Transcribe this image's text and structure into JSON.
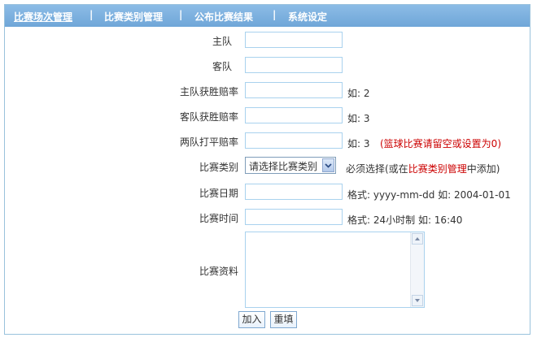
{
  "nav": {
    "items": [
      "比赛场次管理",
      "比赛类别管理",
      "公布比赛结果",
      "系统设定"
    ],
    "separator": "|"
  },
  "form": {
    "home_team": {
      "label": "主队",
      "value": ""
    },
    "away_team": {
      "label": "客队",
      "value": ""
    },
    "home_win_odds": {
      "label": "主队获胜赔率",
      "value": "",
      "hint": "如: 2"
    },
    "away_win_odds": {
      "label": "客队获胜赔率",
      "value": "",
      "hint": "如: 3"
    },
    "draw_odds": {
      "label": "两队打平赔率",
      "value": "",
      "hint": "如: 3",
      "note": "(篮球比赛请留空或设置为0)"
    },
    "category": {
      "label": "比赛类别",
      "selected": "请选择比赛类别",
      "hint_prefix": "必须选择(或在",
      "hint_link": "比赛类别管理",
      "hint_suffix": "中添加)"
    },
    "date": {
      "label": "比赛日期",
      "value": "",
      "hint": "格式: yyyy-mm-dd  如: 2004-01-01"
    },
    "time": {
      "label": "比赛时间",
      "value": "",
      "hint": "格式: 24小时制  如: 16:40"
    },
    "info": {
      "label": "比赛资料",
      "value": ""
    }
  },
  "buttons": {
    "submit": "加入",
    "reset": "重填"
  },
  "colors": {
    "nav_bg": "#7ab0df",
    "border": "#9ac2dc",
    "accent_red": "#cc0000"
  }
}
